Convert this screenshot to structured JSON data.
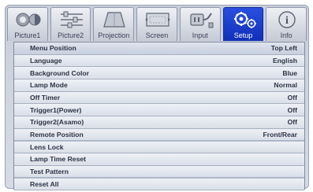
{
  "tabs": [
    {
      "label": "Picture1",
      "icon": "picture-icon",
      "active": false
    },
    {
      "label": "Picture2",
      "icon": "sliders-icon",
      "active": false
    },
    {
      "label": "Projection",
      "icon": "projection-icon",
      "active": false
    },
    {
      "label": "Screen",
      "icon": "screen-icon",
      "active": false
    },
    {
      "label": "Input",
      "icon": "input-connector-icon",
      "active": false
    },
    {
      "label": "Setup",
      "icon": "gears-icon",
      "active": true
    },
    {
      "label": "Info",
      "icon": "info-icon",
      "active": false
    }
  ],
  "menu": {
    "items": [
      {
        "label": "Menu Position",
        "value": "Top Left"
      },
      {
        "label": "Language",
        "value": "English"
      },
      {
        "label": "Background Color",
        "value": "Blue"
      },
      {
        "label": "Lamp Mode",
        "value": "Normal"
      },
      {
        "label": "Off Timer",
        "value": "Off"
      },
      {
        "label": "Trigger1(Power)",
        "value": "Off"
      },
      {
        "label": "Trigger2(Asamo)",
        "value": "Off"
      },
      {
        "label": "Remote Position",
        "value": "Front/Rear"
      },
      {
        "label": "Lens Lock",
        "value": ""
      },
      {
        "label": "Lamp Time Reset",
        "value": ""
      },
      {
        "label": "Test Pattern",
        "value": ""
      },
      {
        "label": "Reset All",
        "value": ""
      }
    ]
  },
  "colors": {
    "active_tab": "#1a3dd0",
    "row_bg": "#e6e9f0",
    "text": "#2c3345"
  }
}
